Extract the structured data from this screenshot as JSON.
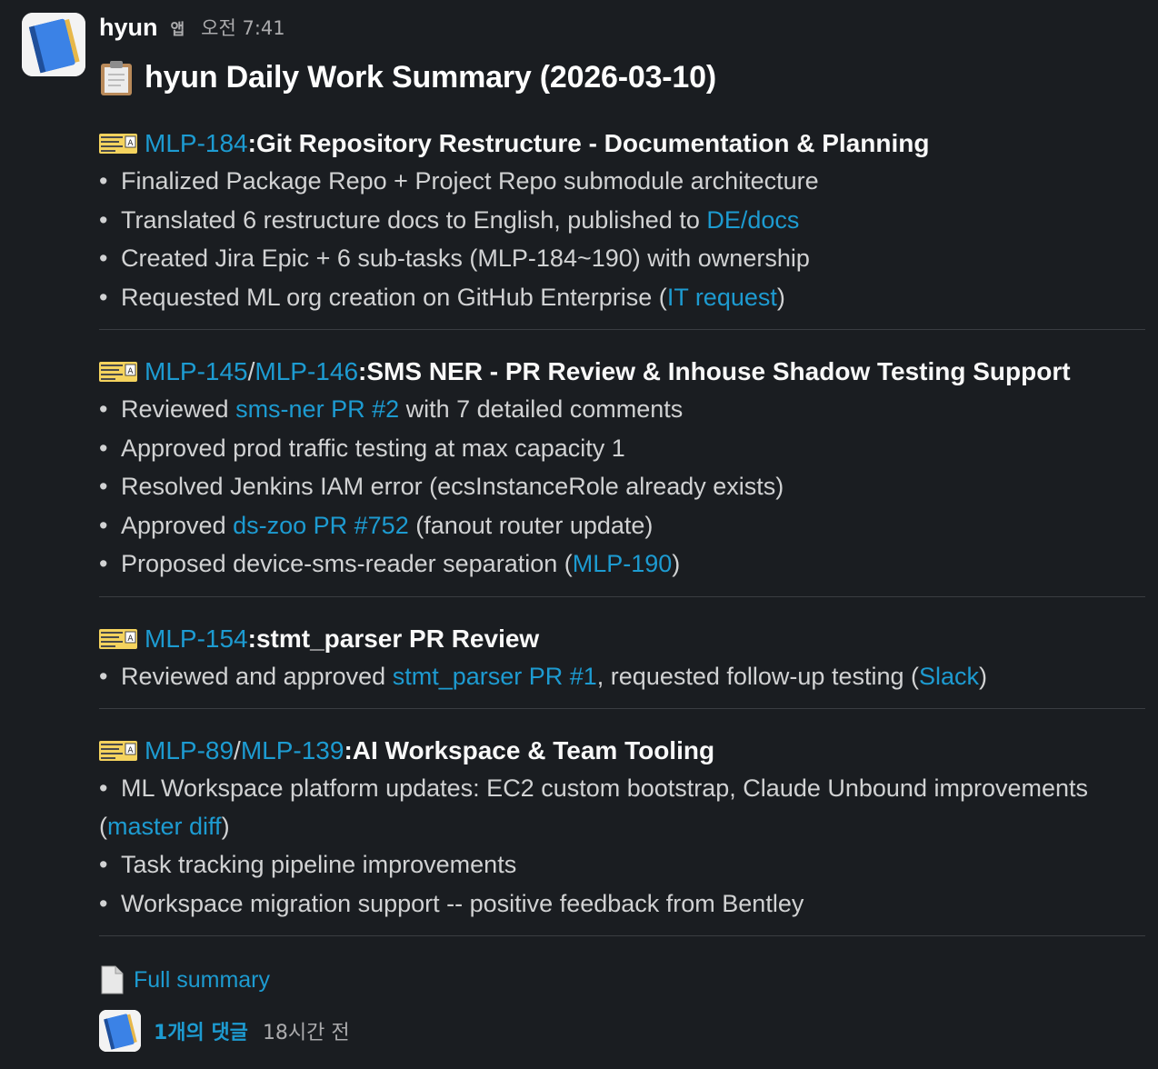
{
  "message": {
    "sender": "hyun",
    "app_badge": "앱",
    "timestamp": "오전 7:41",
    "title_emoji": "clipboard-icon",
    "title": "hyun Daily Work Summary (2026-03-10)"
  },
  "sections": [
    {
      "ticket_icon": "ticket-icon",
      "links": [
        "MLP-184"
      ],
      "separator": " / ",
      "title": "Git Repository Restructure - Documentation & Planning",
      "bullets": [
        {
          "pre": "Finalized Package Repo + Project Repo submodule architecture"
        },
        {
          "pre": "Translated 6 restructure docs to English, published to ",
          "link": "DE/docs"
        },
        {
          "pre": "Created Jira Epic + 6 sub-tasks (MLP-184~190) with ownership"
        },
        {
          "pre": "Requested ML org creation on GitHub Enterprise (",
          "link": "IT request",
          "post": ")"
        }
      ]
    },
    {
      "ticket_icon": "ticket-icon",
      "links": [
        "MLP-145",
        "MLP-146"
      ],
      "separator": " / ",
      "title": "SMS NER - PR Review & Inhouse Shadow Testing Support",
      "bullets": [
        {
          "pre": "Reviewed ",
          "link": "sms-ner PR #2",
          "post": " with 7 detailed comments"
        },
        {
          "pre": "Approved prod traffic testing at max capacity 1"
        },
        {
          "pre": "Resolved Jenkins IAM error (ecsInstanceRole already exists)"
        },
        {
          "pre": "Approved ",
          "link": "ds-zoo PR #752",
          "post": " (fanout router update)"
        },
        {
          "pre": "Proposed device-sms-reader separation (",
          "link": "MLP-190",
          "post": ")"
        }
      ]
    },
    {
      "ticket_icon": "ticket-icon",
      "links": [
        "MLP-154"
      ],
      "separator": " / ",
      "title": "stmt_parser PR Review",
      "bullets": [
        {
          "pre": "Reviewed and approved ",
          "link": "stmt_parser PR #1",
          "post": ", requested follow-up testing (",
          "link2": "Slack",
          "post2": ")"
        }
      ]
    },
    {
      "ticket_icon": "ticket-icon",
      "links": [
        "MLP-89",
        "MLP-139"
      ],
      "separator": " / ",
      "title": "AI Workspace & Team Tooling",
      "bullets": [
        {
          "pre": "ML Workspace platform updates: EC2 custom bootstrap, Claude Unbound improvements (",
          "link": "master diff",
          "post": ")",
          "wrap": true
        },
        {
          "pre": "Task tracking pipeline improvements"
        },
        {
          "pre": "Workspace migration support -- positive feedback from Bentley"
        }
      ]
    }
  ],
  "attachment": {
    "icon": "document-icon",
    "label": "Full summary"
  },
  "thread": {
    "reply_count": "1개의 댓글",
    "reply_time": "18시간 전"
  },
  "colors": {
    "background": "#1a1d21",
    "link": "#1d9bd1",
    "text": "#d1d2d3",
    "heading": "#f8f8f8"
  }
}
